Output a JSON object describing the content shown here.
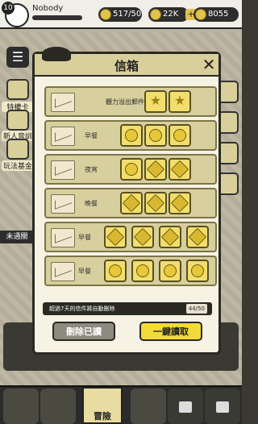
{
  "player": {
    "level": "10",
    "name": "Nobody"
  },
  "resources": {
    "energy": "517/50",
    "coins": "22K",
    "gems": "8055"
  },
  "side_left": [
    {
      "label": "特權卡"
    },
    {
      "label": "新人音訓"
    },
    {
      "label": "玩法基金"
    }
  ],
  "left_status": "未通關",
  "modal": {
    "title": "信箱",
    "mails": [
      {
        "label": "體力溢出郵件",
        "rewards": [
          "star",
          "star"
        ]
      },
      {
        "label": "早餐",
        "rewards": [
          "coin",
          "coin",
          "coin"
        ]
      },
      {
        "label": "夜宵",
        "rewards": [
          "coin",
          "gem",
          "gem"
        ]
      },
      {
        "label": "晚餐",
        "rewards": [
          "gem",
          "gem",
          "gem"
        ]
      },
      {
        "label": "早餐",
        "rewards": [
          "gem",
          "gem",
          "gem",
          "gem"
        ]
      },
      {
        "label": "早餐",
        "rewards": [
          "item",
          "item",
          "item",
          "item"
        ]
      }
    ],
    "info": "超過7天的信件將自動刪除",
    "count": "44/50",
    "delete_label": "刪除已讀",
    "claim_label": "一鍵讀取"
  },
  "bottom_nav": {
    "active_label": "冒險"
  }
}
